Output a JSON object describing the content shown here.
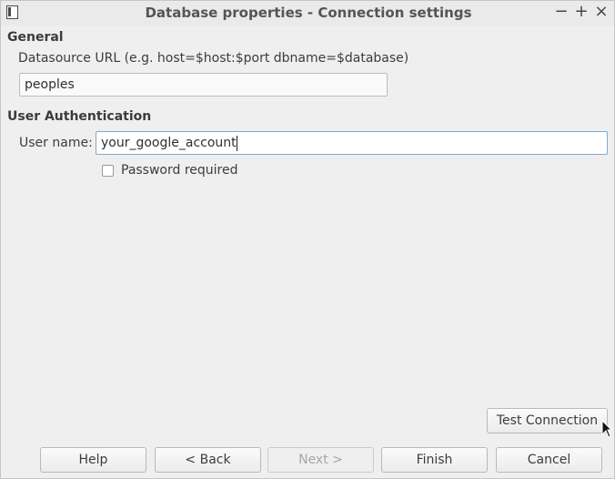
{
  "window": {
    "title": "Database properties - Connection settings",
    "controls": {
      "minimize": "−",
      "maximize": "+",
      "close": "×"
    }
  },
  "general": {
    "heading": "General",
    "datasource_label": "Datasource URL (e.g. host=$host:$port dbname=$database)",
    "datasource_value": "peoples"
  },
  "auth": {
    "heading": "User Authentication",
    "username_label": "User name:",
    "username_value": "your_google_account",
    "password_required_label": "Password required",
    "password_required_checked": false
  },
  "buttons": {
    "test_connection": "Test Connection",
    "help": "Help",
    "back": "< Back",
    "next": "Next >",
    "finish": "Finish",
    "cancel": "Cancel"
  }
}
